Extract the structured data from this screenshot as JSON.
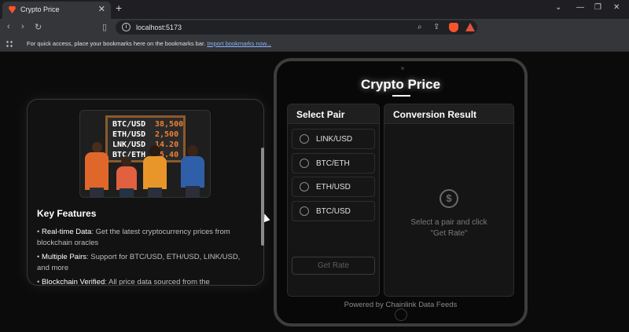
{
  "browser": {
    "tab_title": "Crypto Price",
    "tab_close": "✕",
    "new_tab": "+",
    "url": "localhost:5173",
    "bookmarks_text": "For quick access, place your bookmarks here on the bookmarks bar.",
    "bookmarks_link": "Import bookmarks now..."
  },
  "features": {
    "title": "Key Features",
    "items": [
      {
        "label": "Real-time Data",
        "text": ": Get the latest cryptocurrency prices from blockchain oracles"
      },
      {
        "label": "Multiple Pairs",
        "text": ": Support for BTC/USD, ETH/USD, LINK/USD, and more"
      },
      {
        "label": "Blockchain Verified",
        "text": ": All price data sourced from the"
      }
    ],
    "board": [
      {
        "pair": "BTC/USD",
        "price": "38,500"
      },
      {
        "pair": "ETH/USD",
        "price": "2,500"
      },
      {
        "pair": "LNK/USD",
        "price": "14.20"
      },
      {
        "pair": "BTC/ETH",
        "price": "15.40"
      }
    ]
  },
  "app": {
    "title": "Crypto Price",
    "select_pair_header": "Select Pair",
    "pairs": [
      "LINK/USD",
      "BTC/ETH",
      "ETH/USD",
      "BTC/USD"
    ],
    "get_rate_label": "Get Rate",
    "result_header": "Conversion Result",
    "result_hint": "Select a pair and click\n\"Get Rate\"",
    "footer": "Powered by Chainlink Data Feeds"
  },
  "colors": {
    "accent_price": "#f08030",
    "page_bg": "#0b0b0b"
  }
}
